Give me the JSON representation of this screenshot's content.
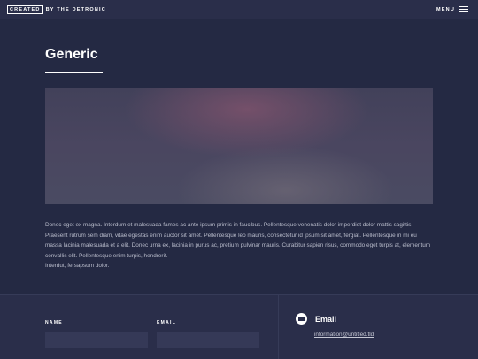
{
  "header": {
    "brand_box": "CREATED",
    "brand_rest": "BY THE DETRONIC",
    "menu_label": "MENU",
    "menu_icon": "hamburger-icon"
  },
  "main": {
    "title": "Generic",
    "paragraphs": [
      "Donec eget ex magna. Interdum et malesuada fames ac ante ipsum primis in faucibus. Pellentesque venenatis dolor imperdiet dolor mattis sagittis. Praesent rutrum sem diam, vitae egestas enim auctor sit amet. Pellentesque leo mauris, consectetur id ipsum sit amet, fergiat. Pellentesque in mi eu massa lacinia malesuada et a elit. Donec urna ex, lacinia in purus ac, pretium pulvinar mauris. Curabitur sapien risus, commodo eget turpis at, elementum convallis elit. Pellentesque enim turpis, hendrerit.",
      "Interdut, fersapsum dolor."
    ]
  },
  "footer": {
    "form": {
      "name_label": "NAME",
      "email_label": "EMAIL"
    },
    "contact": {
      "icon": "envelope-icon",
      "heading": "Email",
      "address": "information@untitled.tld"
    }
  },
  "colors": {
    "header_bg": "#2a2e4a",
    "main_bg": "#242943",
    "input_bg": "#353957",
    "text": "#ffffff",
    "body_text": "#b9bccb"
  }
}
